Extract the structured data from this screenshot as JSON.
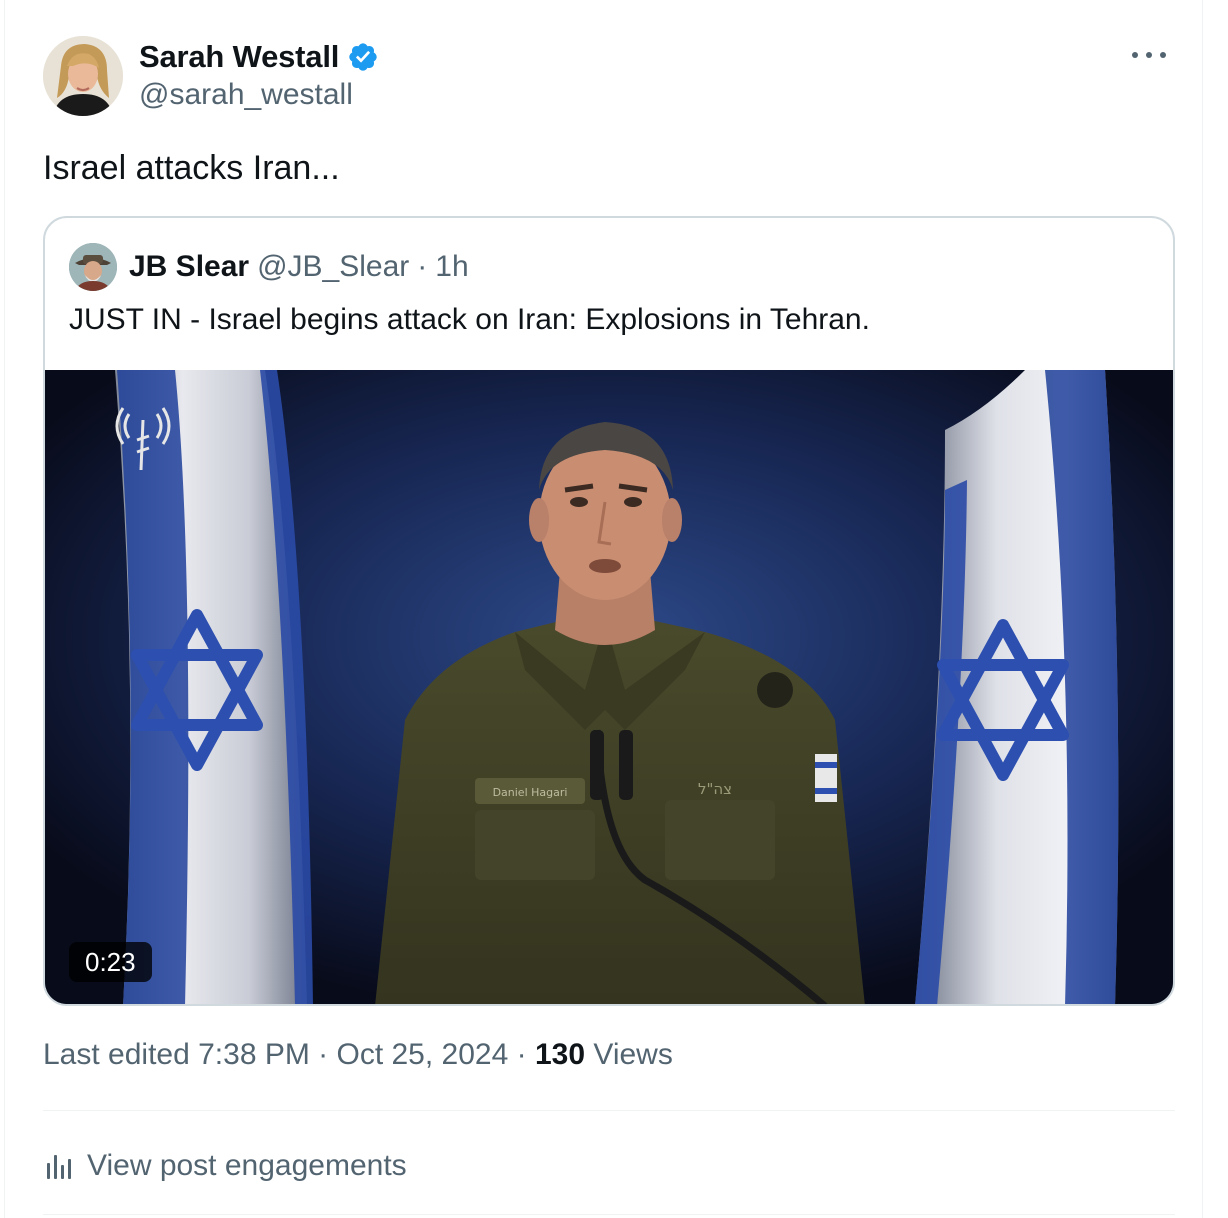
{
  "author": {
    "display_name": "Sarah Westall",
    "handle": "@sarah_westall",
    "verified": true
  },
  "tweet": {
    "text": "Israel attacks Iran..."
  },
  "quoted": {
    "display_name": "JB Slear",
    "handle": "@JB_Slear",
    "separator": "·",
    "time": "1h",
    "text": "JUST IN - Israel begins attack on Iran: Explosions in Tehran.",
    "video": {
      "duration": "0:23",
      "name_tag": "Daniel Hagari",
      "insignia_text": "צה\"ל"
    }
  },
  "meta": {
    "edited_prefix": "Last edited 7:38 PM · Oct 25, 2024 · ",
    "views_count": "130",
    "views_label": " Views"
  },
  "actions": {
    "engagements_label": "View post engagements"
  },
  "colors": {
    "verified": "#1d9bf0",
    "secondary_text": "#536471",
    "flag_blue": "#2c4fb0"
  }
}
